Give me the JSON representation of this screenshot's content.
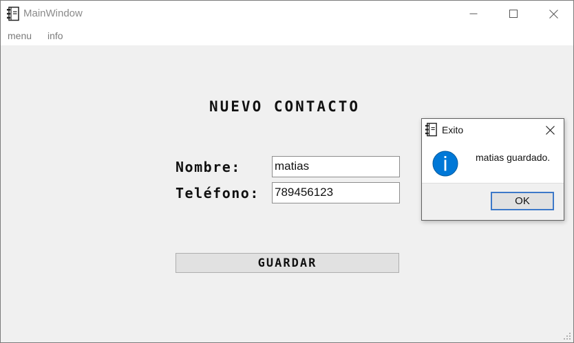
{
  "window": {
    "title": "MainWindow",
    "app_icon": "address-book-icon",
    "controls": [
      "minimize-icon",
      "maximize-icon",
      "close-icon"
    ]
  },
  "menubar": {
    "items": [
      {
        "label": "menu"
      },
      {
        "label": "info"
      }
    ]
  },
  "form": {
    "heading": "NUEVO CONTACTO",
    "name_label": "Nombre:",
    "name_value": "matias",
    "phone_label": "Teléfono:",
    "phone_value": "789456123",
    "save_label": "GUARDAR"
  },
  "dialog": {
    "title": "Exito",
    "icon": "info-icon",
    "message": "matias guardado.",
    "ok_label": "OK"
  },
  "colors": {
    "accent": "#0078d7",
    "ok_border": "#3c78c8",
    "background": "#f0f0f0"
  }
}
